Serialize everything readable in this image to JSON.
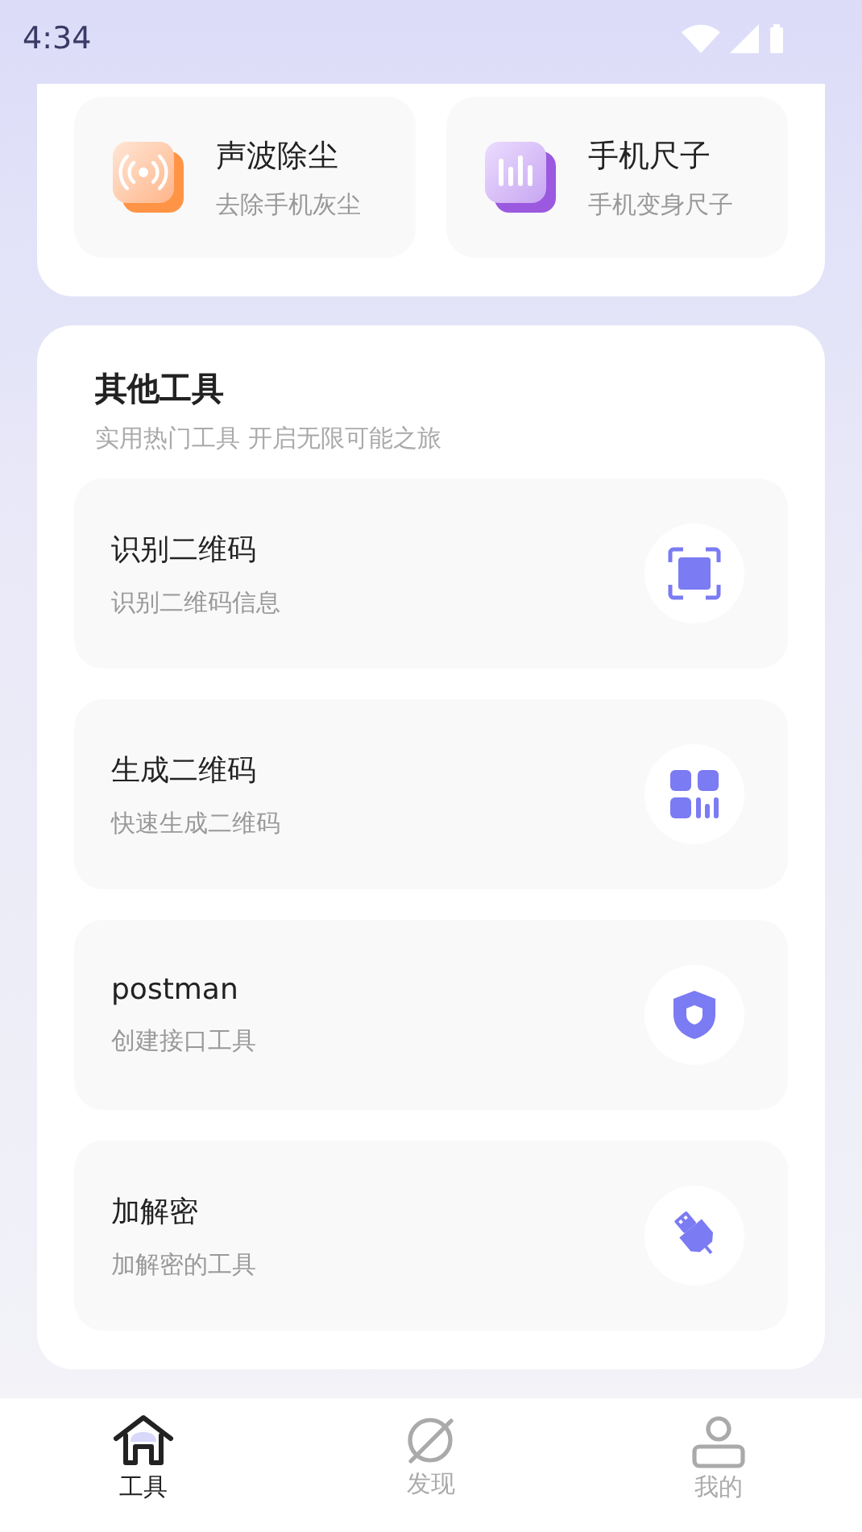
{
  "status_bar": {
    "time": "4:34"
  },
  "featured_tools": [
    {
      "title": "声波除尘",
      "subtitle": "去除手机灰尘",
      "kind": "sound"
    },
    {
      "title": "手机尺子",
      "subtitle": "手机变身尺子",
      "kind": "ruler"
    }
  ],
  "other_tools": {
    "title": "其他工具",
    "subtitle": "实用热门工具 开启无限可能之旅",
    "items": [
      {
        "title": "识别二维码",
        "subtitle": "识别二维码信息",
        "kind": "scan"
      },
      {
        "title": "生成二维码",
        "subtitle": "快速生成二维码",
        "kind": "qr"
      },
      {
        "title": "postman",
        "subtitle": "创建接口工具",
        "kind": "shield"
      },
      {
        "title": "加解密",
        "subtitle": "加解密的工具",
        "kind": "usb"
      }
    ]
  },
  "bottom_nav": [
    {
      "label": "工具",
      "selected": true,
      "kind": "home"
    },
    {
      "label": "发现",
      "selected": false,
      "kind": "planet"
    },
    {
      "label": "我的",
      "selected": false,
      "kind": "user"
    }
  ]
}
